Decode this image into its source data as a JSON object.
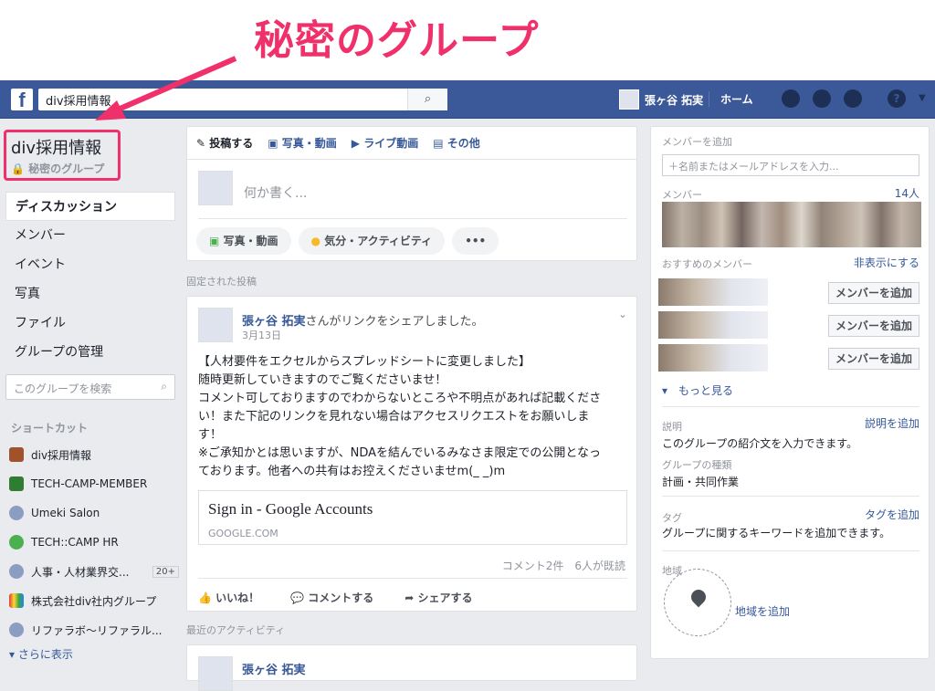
{
  "annotation": {
    "title": "秘密のグループ"
  },
  "topbar": {
    "logo": "f",
    "search_value": "div採用情報",
    "user_name": "張ヶ谷 拓実",
    "home_label": "ホーム",
    "help": "?"
  },
  "left": {
    "group_name": "div採用情報",
    "group_privacy": "🔒 秘密のグループ",
    "nav": [
      "ディスカッション",
      "メンバー",
      "イベント",
      "写真",
      "ファイル",
      "グループの管理"
    ],
    "search_placeholder": "このグループを検索",
    "shortcuts_title": "ショートカット",
    "shortcuts": [
      {
        "label": "div採用情報",
        "color": "#a0522d"
      },
      {
        "label": "TECH-CAMP-MEMBER",
        "color": "#2e7d32"
      },
      {
        "label": "Umeki Salon",
        "color": "#5b73a9"
      },
      {
        "label": "TECH::CAMP HR",
        "color": "#4caf50"
      },
      {
        "label": "人事・人材業界交...",
        "color": "#5b73a9",
        "badge": "20+"
      },
      {
        "label": "株式会社div社内グループ",
        "color": "#e67e22"
      },
      {
        "label": "リファラボ〜リファラル...",
        "color": "#5b73a9"
      }
    ],
    "see_more": "▾ さらに表示"
  },
  "composer": {
    "tabs": [
      "投稿する",
      "写真・動画",
      "ライブ動画",
      "その他"
    ],
    "placeholder": "何か書く...",
    "pills": [
      "写真・動画",
      "気分・アクティビティ",
      "•••"
    ]
  },
  "pinned_label": "固定された投稿",
  "post": {
    "author": "張ヶ谷 拓実",
    "action": "さんがリンクをシェアしました。",
    "date": "3月13日",
    "body": [
      "【人材要件をエクセルからスプレッドシートに変更しました】",
      "随時更新していきますのでご覧くださいませ！",
      "コメント可しておりますのでわからないところや不明点があれば記載くださ",
      "い！また下記のリンクを見れない場合はアクセスリクエストをお願いしま",
      "す！",
      "※ご承知かとは思いますが、NDAを結んでいるみなさま限定での公開となっ",
      "ております。他者への共有はお控えくださいませm(_ _)m"
    ],
    "link_title": "Sign in - Google Accounts",
    "link_domain": "GOOGLE.COM",
    "stats": "コメント2件　6人が既読",
    "actions": [
      "いいね！",
      "コメントする",
      "シェアする"
    ]
  },
  "recent_label": "最近のアクティビティ",
  "post2_author": "張ヶ谷 拓実",
  "right": {
    "add_member_label": "メンバーを追加",
    "add_member_placeholder": "＋名前またはメールアドレスを入力...",
    "members_label": "メンバー",
    "members_count": "14人",
    "suggested_label": "おすすめのメンバー",
    "hide_link": "非表示にする",
    "add_button": "メンバーを追加",
    "see_more": "▾　もっと見る",
    "desc_label": "説明",
    "desc_link": "説明を追加",
    "desc_text": "このグループの紹介文を入力できます。",
    "type_label": "グループの種類",
    "type_text": "計画・共同作業",
    "tag_label": "タグ",
    "tag_link": "タグを追加",
    "tag_text": "グループに関するキーワードを追加できます。",
    "region_label": "地域",
    "region_link": "地域を追加"
  }
}
